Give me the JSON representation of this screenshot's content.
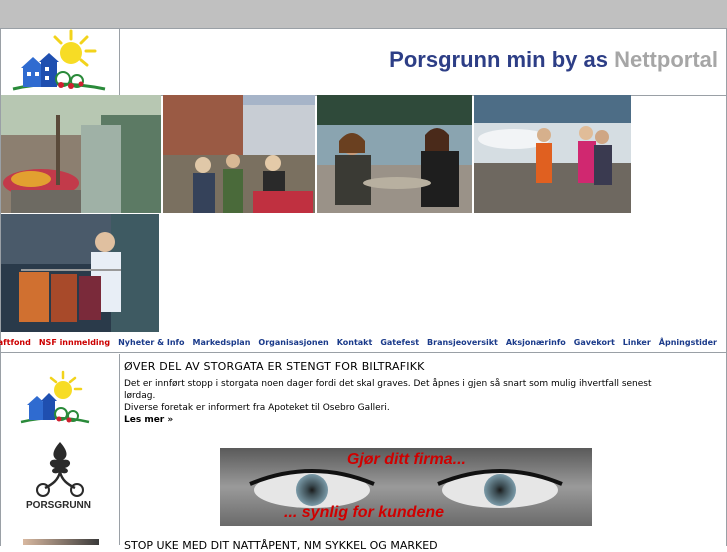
{
  "header": {
    "title_main": "Porsgrunn min by as",
    "title_sub": "Nettportal"
  },
  "nav": {
    "items": [
      {
        "label": "NSF kraftfond"
      },
      {
        "label": "NSF innmelding"
      },
      {
        "label": "Nyheter & Info"
      },
      {
        "label": "Markedsplan"
      },
      {
        "label": "Organisasjonen"
      },
      {
        "label": "Kontakt"
      },
      {
        "label": "Gatefest"
      },
      {
        "label": "Bransjeoversikt"
      },
      {
        "label": "Aksjonærinfo"
      },
      {
        "label": "Gavekort"
      },
      {
        "label": "Linker"
      },
      {
        "label": "Åpningstider"
      }
    ]
  },
  "sidebar": {
    "logo2_text": "PORSGRUNN"
  },
  "article": {
    "headline": "ØVER DEL AV STORGATA ER STENGT FOR BILTRAFIKK",
    "line1": "Det er innført stopp i storgata noen dager fordi det skal graves. Det åpnes i gjen så snart som mulig ihvertfall senest",
    "line2": "lørdag.",
    "line3": "Diverse foretak er informert fra Apoteket til Osebro Galleri.",
    "more": "Les mer »"
  },
  "banner": {
    "text1": "Gjør ditt firma...",
    "text2": "... synlig for kundene"
  },
  "article2": {
    "headline": "STOP UKE MED DIT NATTÅPENT, NM SYKKEL OG MARKED"
  },
  "colors": {
    "title_blue": "#2d3e86",
    "title_grey": "#a6a6a6",
    "nav_blue": "#1a3a8a",
    "nav_red": "#cc0000",
    "banner_red": "#d00000"
  }
}
